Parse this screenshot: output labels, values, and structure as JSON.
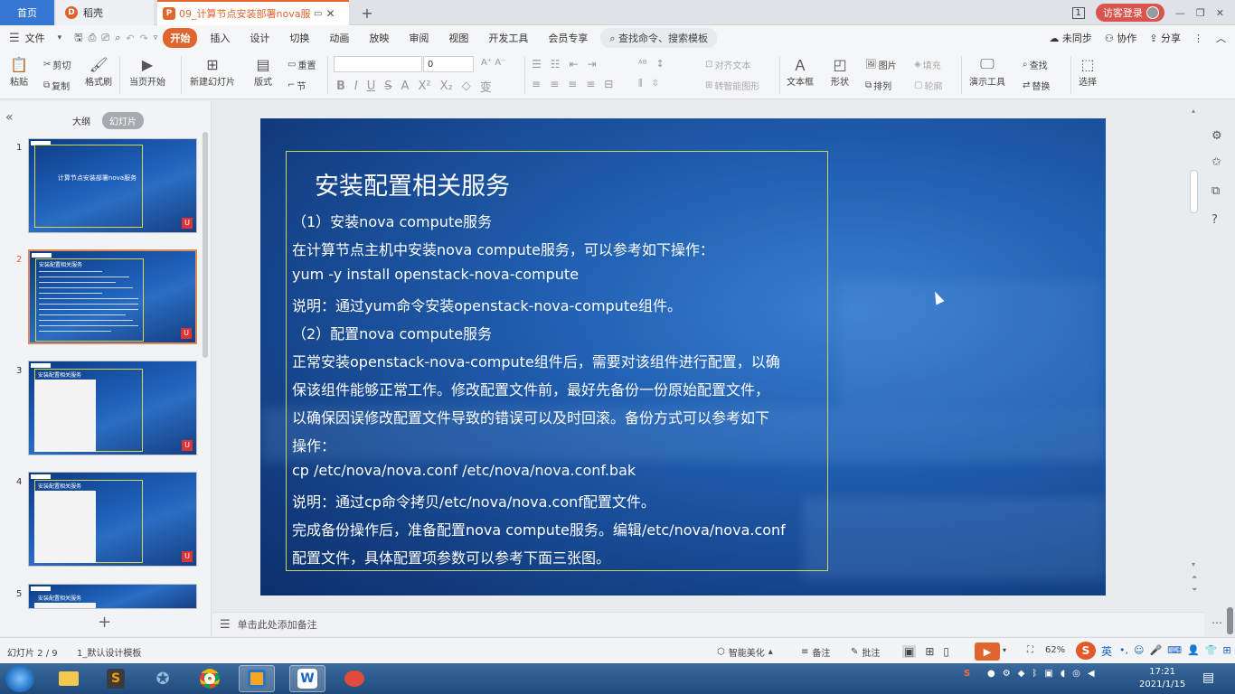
{
  "tabs": {
    "home": "首页",
    "daoke": "稻壳",
    "document": "09_计算节点安装部署nova服务"
  },
  "window": {
    "page_indicator": "1",
    "login": "访客登录"
  },
  "menu": {
    "file": "文件",
    "items": [
      "开始",
      "插入",
      "设计",
      "切换",
      "动画",
      "放映",
      "审阅",
      "视图",
      "开发工具",
      "会员专享"
    ],
    "search": "查找命令、搜索模板",
    "sync": "未同步",
    "collab": "协作",
    "share": "分享"
  },
  "ribbon": {
    "paste": "粘贴",
    "cut": "剪切",
    "copy": "复制",
    "format_painter": "格式刷",
    "from_current": "当页开始",
    "new_slide": "新建幻灯片",
    "layout": "版式",
    "reset": "重置",
    "section": "节",
    "font_size": "0",
    "align_text": "对齐文本",
    "smartart": "转智能图形",
    "textbox": "文本框",
    "shape": "形状",
    "picture": "图片",
    "arrange": "排列",
    "fill": "填充",
    "outline": "轮廓",
    "presentation_tools": "演示工具",
    "find": "查找",
    "replace": "替换",
    "select": "选择"
  },
  "left_panel": {
    "outline_tab": "大纲",
    "slides_tab": "幻灯片",
    "slide_numbers": [
      "1",
      "2",
      "3",
      "4",
      "5"
    ],
    "thumb1_title": "计算节点安装部署nova服务",
    "thumb_title_small": "安装配置相关服务"
  },
  "slide": {
    "title": "安装配置相关服务",
    "lines": [
      "（1）安装nova compute服务",
      "在计算节点主机中安装nova compute服务，可以参考如下操作：",
      "yum -y install openstack-nova-compute",
      "说明：通过yum命令安装openstack-nova-compute组件。",
      "（2）配置nova compute服务",
      "正常安装openstack-nova-compute组件后，需要对该组件进行配置，以确",
      "保该组件能够正常工作。修改配置文件前，最好先备份一份原始配置文件，",
      "以确保因误修改配置文件导致的错误可以及时回滚。备份方式可以参考如下",
      "操作：",
      "cp /etc/nova/nova.conf /etc/nova/nova.conf.bak",
      "说明：通过cp命令拷贝/etc/nova/nova.conf配置文件。",
      "完成备份操作后，准备配置nova compute服务。编辑/etc/nova/nova.conf",
      "配置文件，具体配置项参数可以参考下面三张图。"
    ]
  },
  "notes": {
    "placeholder": "单击此处添加备注"
  },
  "status": {
    "slide_count": "幻灯片 2 / 9",
    "template": "1_默认设计模板",
    "beautify": "智能美化",
    "notes": "备注",
    "comments": "批注",
    "zoom": "62%"
  },
  "taskbar": {
    "ime": "英",
    "time": "17:21",
    "date": "2021/1/15"
  }
}
